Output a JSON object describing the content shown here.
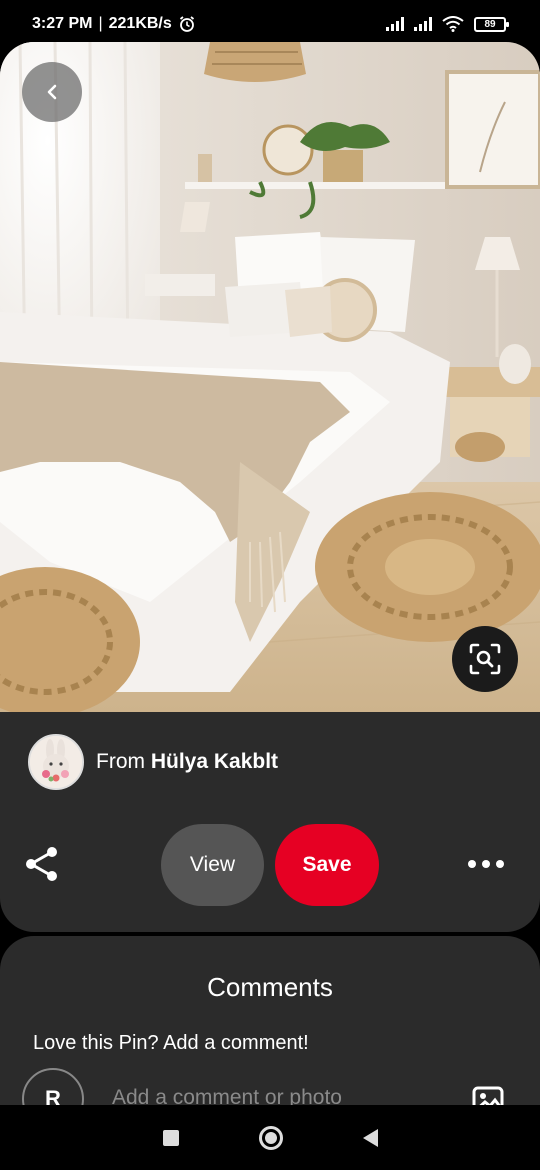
{
  "status_bar": {
    "time": "3:27 PM",
    "speed": "221KB/s",
    "battery": "89",
    "icons": [
      "alarm-icon",
      "signal-icon",
      "signal-icon",
      "wifi-icon",
      "battery-icon"
    ]
  },
  "pin": {
    "image_description_icon": "bedroom-photo",
    "back_icon": "chevron-left-icon",
    "lens_icon": "visual-search-icon"
  },
  "creator": {
    "from_label": "From",
    "name": "Hülya Kakblt"
  },
  "actions": {
    "view_label": "View",
    "save_label": "Save",
    "share_icon": "share-icon",
    "more_icon": "more-icon",
    "colors": {
      "save": "#e60023",
      "view": "#555555",
      "background": "#2b2b2b"
    }
  },
  "comments": {
    "title": "Comments",
    "prompt": "Love this Pin? Add a comment!",
    "avatar_initial": "R",
    "placeholder": "Add a comment or photo"
  },
  "nav_bar": {
    "icons": [
      "recents-icon",
      "home-icon",
      "back-icon"
    ]
  }
}
